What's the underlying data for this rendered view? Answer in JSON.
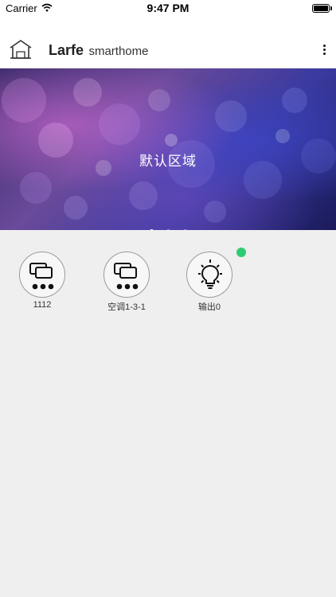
{
  "status_bar": {
    "carrier": "Carrier",
    "time": "9:47 PM"
  },
  "header": {
    "brand_name": "Larfe",
    "brand_sub": "smarthome"
  },
  "banner": {
    "title": "默认区域",
    "page_count": 3,
    "active_page": 1
  },
  "devices": [
    {
      "label": "1112",
      "icon": "ac-controller-icon"
    },
    {
      "label": "空调1-3-1",
      "icon": "ac-controller-icon"
    },
    {
      "label": "输出0",
      "icon": "light-bulb-icon",
      "online": true
    }
  ],
  "colors": {
    "online": "#2ecc71",
    "header_bg": "#ffffff",
    "page_bg": "#efefef"
  }
}
